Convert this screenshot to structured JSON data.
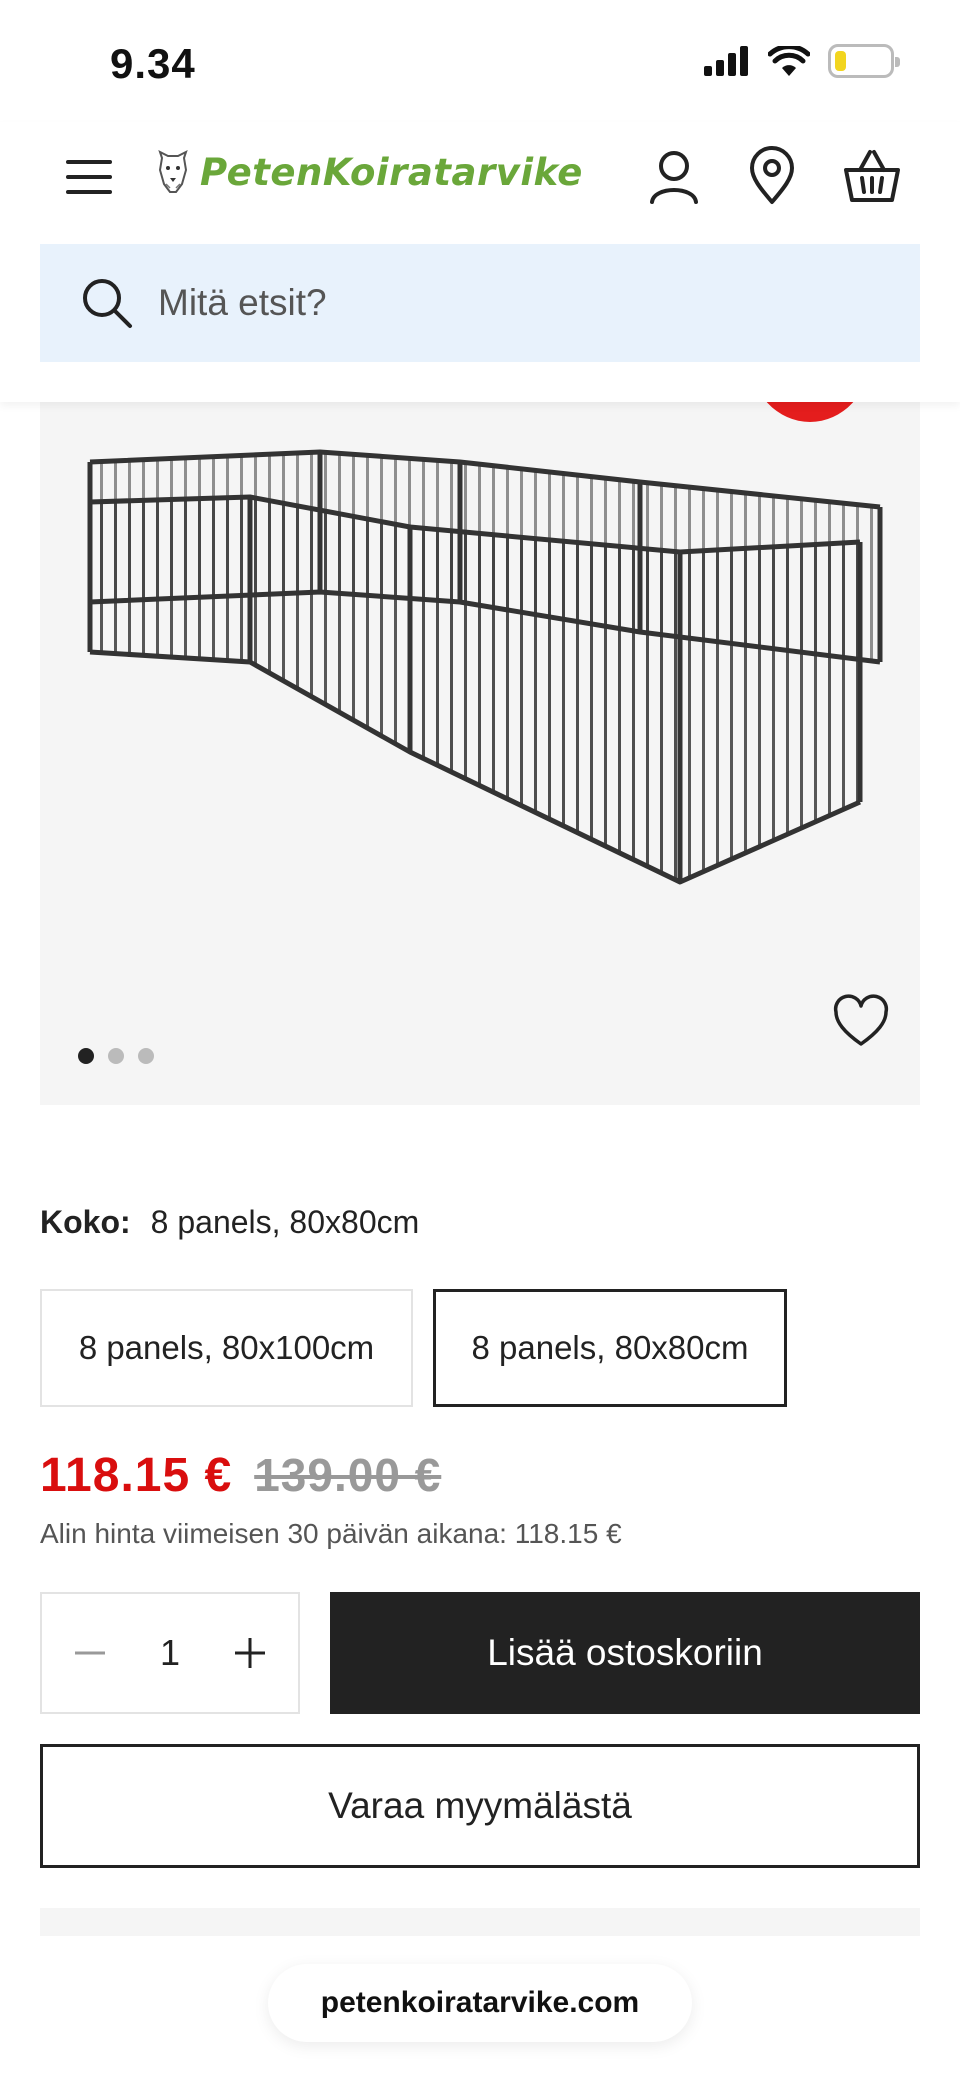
{
  "status_bar": {
    "time": "9.34",
    "icons": [
      "signal-icon",
      "wifi-icon",
      "battery-icon"
    ],
    "battery_level": 0.2
  },
  "header": {
    "logo_text": "PetenKoiratarvike",
    "icons": [
      "menu-icon",
      "account-icon",
      "location-icon",
      "basket-icon"
    ],
    "brand_color": "#6aa73a"
  },
  "search": {
    "placeholder": "Mitä etsit?"
  },
  "gallery": {
    "image_count": 3,
    "active_index": 0
  },
  "variant": {
    "label": "Koko:",
    "selected": "8 panels, 80x80cm",
    "options": [
      "8 panels, 80x100cm",
      "8 panels, 80x80cm"
    ]
  },
  "price": {
    "current": "118.15 €",
    "original": "139.00 €",
    "lowest_note": "Alin hinta viimeisen 30 päivän aikana: 118.15 €",
    "sale_color": "#d90e0e"
  },
  "cart": {
    "quantity": "1",
    "add_label": "Lisää ostoskoriin",
    "reserve_label": "Varaa myymälästä"
  },
  "browser": {
    "url": "petenkoiratarvike.com"
  }
}
